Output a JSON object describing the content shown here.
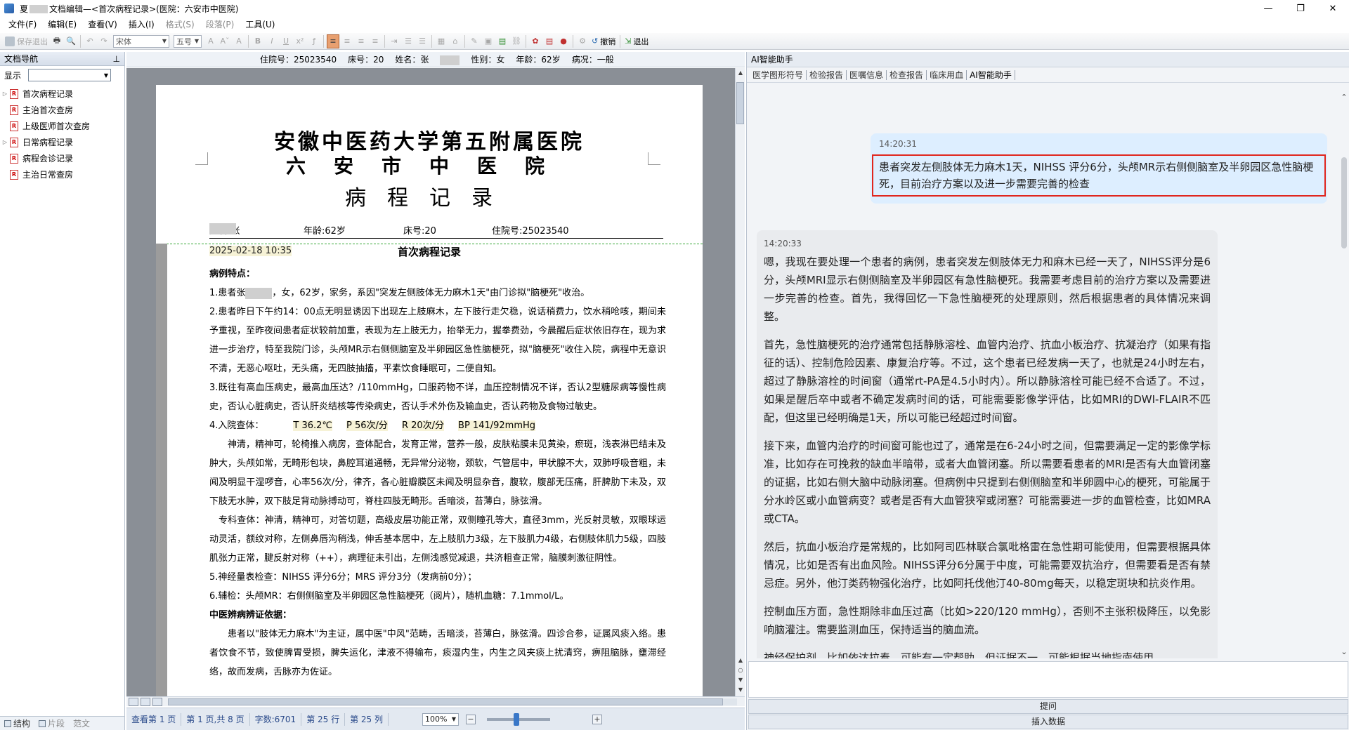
{
  "window": {
    "title_prefix": "夏",
    "title_suffix": "文档编辑—<首次病程记录>(医院：六安市中医院)",
    "controls": [
      "—",
      "❐",
      "✕"
    ]
  },
  "menu": [
    {
      "label": "文件(F)",
      "enabled": true
    },
    {
      "label": "编辑(E)",
      "enabled": true
    },
    {
      "label": "查看(V)",
      "enabled": true
    },
    {
      "label": "插入(I)",
      "enabled": true
    },
    {
      "label": "格式(S)",
      "enabled": false
    },
    {
      "label": "段落(P)",
      "enabled": false
    },
    {
      "label": "工具(U)",
      "enabled": true
    }
  ],
  "toolbar": {
    "save_exit": "保存退出",
    "font_name": "宋体",
    "font_size": "五号",
    "undo": "撤销",
    "exit": "退出"
  },
  "left_nav": {
    "title": "文档导航",
    "pin": "⊥",
    "show_label": "显示",
    "items": [
      {
        "label": "首次病程记录",
        "expandable": true
      },
      {
        "label": "主治首次查房",
        "expandable": false
      },
      {
        "label": "上级医师首次查房",
        "expandable": false
      },
      {
        "label": "日常病程记录",
        "expandable": true
      },
      {
        "label": "病程会诊记录",
        "expandable": false
      },
      {
        "label": "主治日常查房",
        "expandable": false
      }
    ],
    "bottom_tabs": [
      "结构",
      "片段",
      "范文"
    ]
  },
  "doc_strip": {
    "admission": "住院号：25023540",
    "bed": "床号：20",
    "name": "姓名：张",
    "gender": "性别：女",
    "age": "年龄：62岁",
    "condition": "病况：一般"
  },
  "document": {
    "hospital_line1": "安徽中医药大学第五附属医院",
    "hospital_line2": "六安市中医院",
    "record_title": "病程记录",
    "patient_name": "姓名:张",
    "patient_age": "年龄:62岁",
    "patient_bed": "床号:20",
    "patient_admission": "住院号:25023540",
    "date": "2025-02-18 10:35",
    "section_title": "首次病程记录",
    "h_features": "病例特点：",
    "p1a": "1.患者张",
    "p1b": "，女，62岁，家务，系因\"突发左侧肢体无力麻木1天\"由门诊拟\"脑梗死\"收治。",
    "p2": "2.患者昨日下午约14：00点无明显诱因下出现左上肢麻木，左下肢行走欠稳，说话稍费力，饮水稍呛咳，期间未予重视，至昨夜间患者症状较前加重，表现为左上肢无力，抬举无力，握拳费劲，今晨醒后症状依旧存在，现为求进一步治疗，特至我院门诊，头颅MR示右侧侧脑室及半卵园区急性脑梗死，拟\"脑梗死\"收住入院，病程中无意识不清，无恶心呕吐，无头痛，无四肢抽搐，平素饮食睡眠可，二便自知。",
    "p3": "3.既往有高血压病史，最高血压达？/110mmHg，口服药物不详，血压控制情况不详，否认2型糖尿病等慢性病史，否认心脏病史，否认肝炎结核等传染病史，否认手术外伤及输血史，否认药物及食物过敏史。",
    "p4_label": "4.入院查体：",
    "p4_t": "T 36.2℃",
    "p4_p": "P 56次/分",
    "p4_r": "R 20次/分",
    "p4_bp": "BP 141/92mmHg",
    "p4_body": "神清，精神可，轮椅推入病房，查体配合，发育正常，营养一般，皮肤粘膜未见黄染，瘀斑，浅表淋巴结未及肿大，头颅如常，无畸形包块，鼻腔耳道通畅，无异常分泌物，颈软，气管居中，甲状腺不大，双肺呼吸音粗，未闻及明显干湿啰音，心率56次/分，律齐，各心脏瓣膜区未闻及明显杂音，腹软，腹部无压痛，肝脾肋下未及，双下肢无水肿，双下肢足背动脉搏动可，脊柱四肢无畸形。舌暗淡，苔薄白，脉弦滑。",
    "p4_neuro": "专科查体：神清，精神可，对答切题，高级皮层功能正常，双侧瞳孔等大，直径3mm，光反射灵敏，双眼球运动灵活，额纹对称，左侧鼻唇沟稍浅，伸舌基本居中，左上肢肌力3级，左下肢肌力4级，右侧肢体肌力5级，四肢肌张力正常，腱反射对称（++），病理征未引出，左侧浅感觉减退，共济粗查正常，脑膜刺激征阴性。",
    "p5": "5.神经量表检查：NIHSS 评分6分；MRS 评分3分（发病前0分）；",
    "p6": "6.辅检：头颅MR：右侧侧脑室及半卵园区急性脑梗死（阅片），随机血糖：7.1mmol/L。",
    "h_tcm": "中医辨病辨证依据：",
    "p7": "患者以\"肢体无力麻木\"为主证，属中医\"中风\"范畴，舌暗淡，苔薄白，脉弦滑。四诊合参，证属风痰入络。患者饮食不节，致使脾胃受损，脾失运化，津液不得输布，痰湿内生，内生之风夹痰上扰清窍，痹阻脑脉，壅滞经络，故而发病，舌脉亦为佐证。"
  },
  "statusbar": {
    "page": "查看第 1 页",
    "page_of": "第 1 页,共 8 页",
    "chars": "字数:6701",
    "line": "第 25 行",
    "col": "第 25 列",
    "zoom": "100%"
  },
  "ai_panel": {
    "title": "AI智能助手",
    "tabs": [
      {
        "label": "医学图形符号",
        "active": false
      },
      {
        "label": "检验报告",
        "active": false
      },
      {
        "label": "医嘱信息",
        "active": false
      },
      {
        "label": "检查报告",
        "active": false
      },
      {
        "label": "临床用血",
        "active": false
      },
      {
        "label": "AI智能助手",
        "active": true
      }
    ],
    "user_time": "14:20:31",
    "user_msg": "患者突发左侧肢体无力麻木1天，NIHSS 评分6分，头颅MR示右侧侧脑室及半卵园区急性脑梗死，目前治疗方案以及进一步需要完善的检查",
    "ai_time": "14:20:33",
    "ai_paragraphs": [
      "嗯，我现在要处理一个患者的病例，患者突发左侧肢体无力和麻木已经一天了，NIHSS评分是6分，头颅MRI显示右侧侧脑室及半卵园区有急性脑梗死。我需要考虑目前的治疗方案以及需要进一步完善的检查。首先，我得回忆一下急性脑梗死的处理原则，然后根据患者的具体情况来调整。",
      "首先，急性脑梗死的治疗通常包括静脉溶栓、血管内治疗、抗血小板治疗、抗凝治疗（如果有指征的话）、控制危险因素、康复治疗等。不过，这个患者已经发病一天了，也就是24小时左右，超过了静脉溶栓的时间窗（通常rt-PA是4.5小时内）。所以静脉溶栓可能已经不合适了。不过，如果是醒后卒中或者不确定发病时间的话，可能需要影像学评估，比如MRI的DWI-FLAIR不匹配，但这里已经明确是1天，所以可能已经超过时间窗。",
      "接下来，血管内治疗的时间窗可能也过了，通常是在6-24小时之间，但需要满足一定的影像学标准，比如存在可挽救的缺血半暗带，或者大血管闭塞。所以需要看患者的MRI是否有大血管闭塞的证据，比如右侧大脑中动脉闭塞。但病例中只提到右侧侧脑室和半卵圆中心的梗死，可能属于分水岭区或小血管病变？或者是否有大血管狭窄或闭塞？可能需要进一步的血管检查，比如MRA或CTA。",
      "然后，抗血小板治疗是常规的，比如阿司匹林联合氯吡格雷在急性期可能使用，但需要根据具体情况，比如是否有出血风险。NIHSS评分6分属于中度，可能需要双抗治疗，但需要看是否有禁忌症。另外，他汀类药物强化治疗，比如阿托伐他汀40-80mg每天，以稳定斑块和抗炎作用。",
      "控制血压方面，急性期除非血压过高（比如>220/120 mmHg），否则不主张积极降压，以免影响脑灌注。需要监测血压，保持适当的脑血流。",
      "神经保护剂，比如依达拉奉，可能有一定帮助，但证据不一，可能根据当地指南使用。"
    ],
    "ask_button": "提问",
    "insert_button": "插入数据"
  }
}
